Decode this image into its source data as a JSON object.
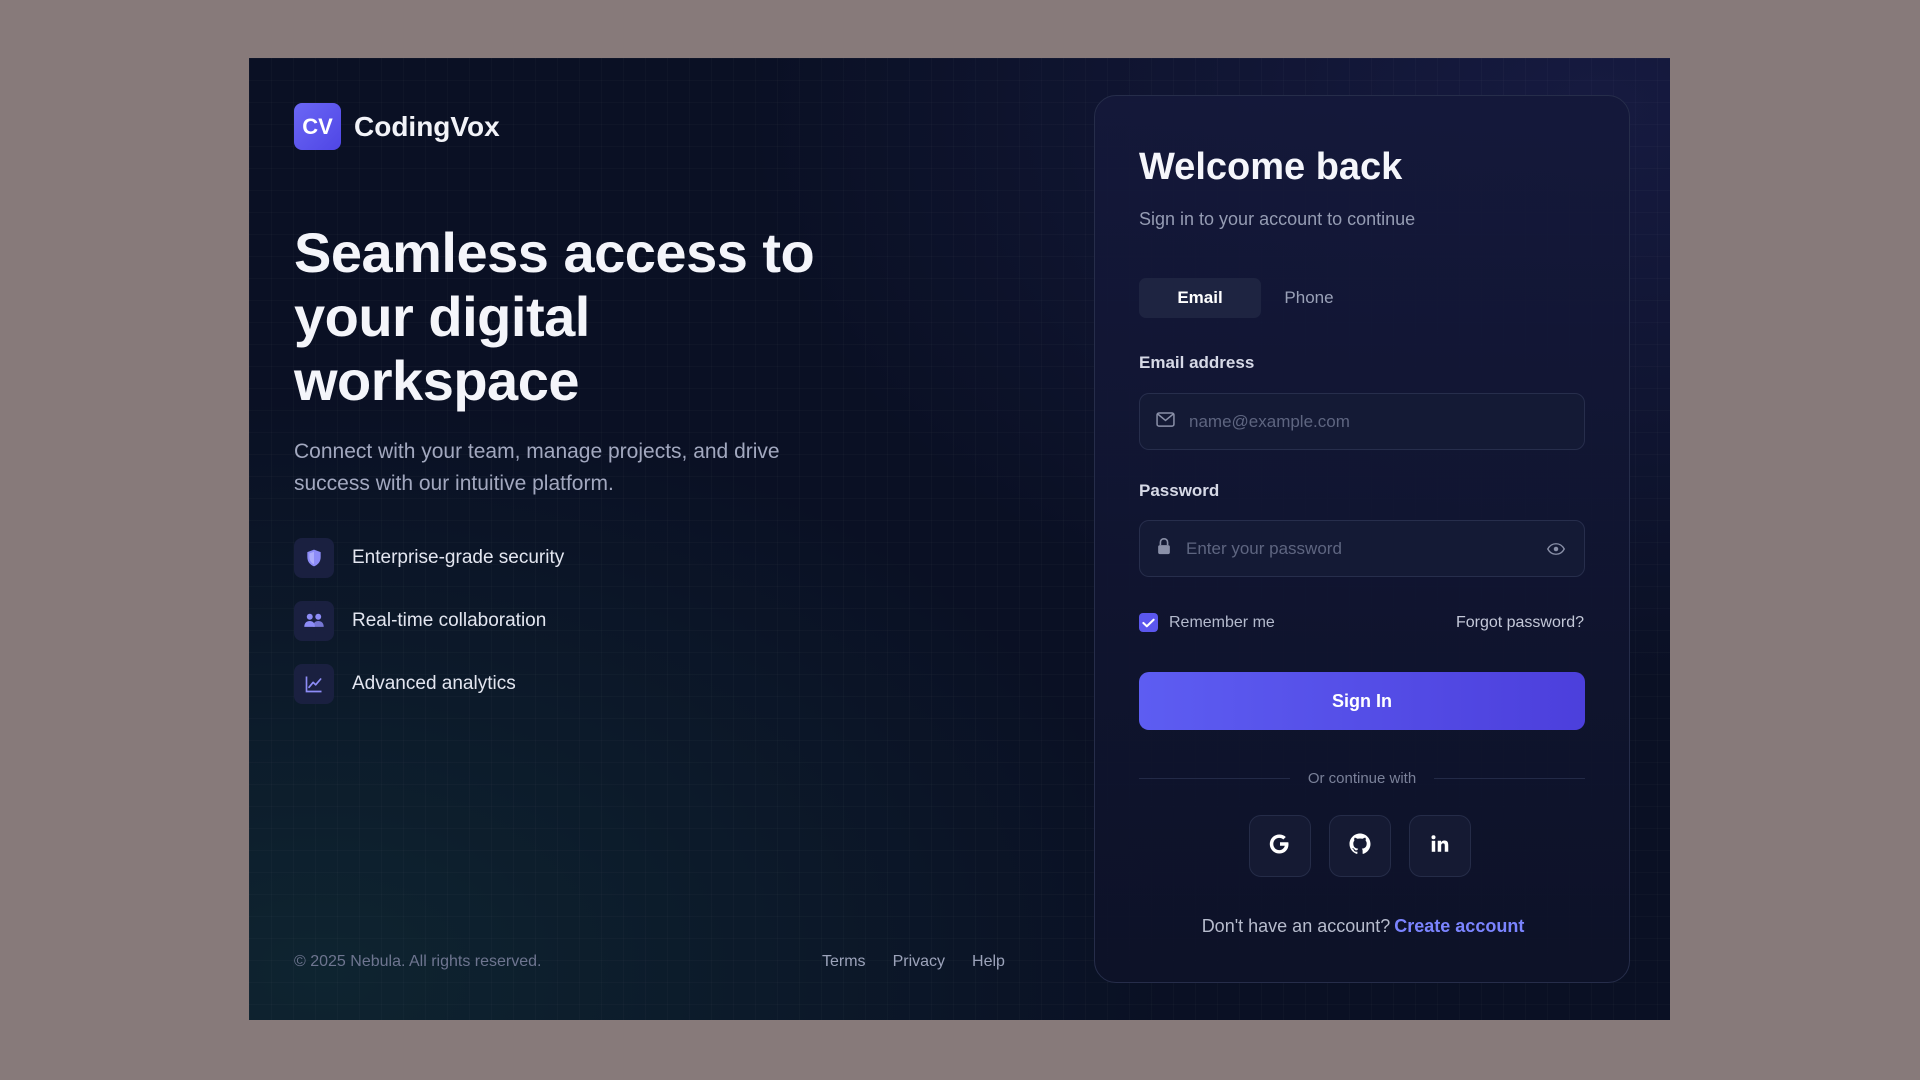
{
  "brand": {
    "logo_text": "CV",
    "name": "CodingVox"
  },
  "hero": {
    "title": "Seamless access to your digital workspace",
    "subtitle": "Connect with your team, manage projects, and drive success with our intuitive platform."
  },
  "features": [
    {
      "icon": "shield-icon",
      "label": "Enterprise-grade security"
    },
    {
      "icon": "users-icon",
      "label": "Real-time collaboration"
    },
    {
      "icon": "chart-line-icon",
      "label": "Advanced analytics"
    }
  ],
  "footer": {
    "copyright": "© 2025 Nebula. All rights reserved.",
    "links": [
      "Terms",
      "Privacy",
      "Help"
    ]
  },
  "login": {
    "title": "Welcome back",
    "subtitle": "Sign in to your account to continue",
    "tabs": [
      {
        "label": "Email",
        "active": true
      },
      {
        "label": "Phone",
        "active": false
      }
    ],
    "email": {
      "label": "Email address",
      "placeholder": "name@example.com",
      "value": ""
    },
    "password": {
      "label": "Password",
      "placeholder": "Enter your password",
      "value": ""
    },
    "remember_label": "Remember me",
    "remember_checked": true,
    "forgot_label": "Forgot password?",
    "submit_label": "Sign In",
    "divider_text": "Or continue with",
    "social": [
      "google-icon",
      "github-icon",
      "linkedin-icon"
    ],
    "signup_prompt": "Don't have an account?",
    "signup_link": "Create account"
  },
  "colors": {
    "page_background": "#877a7a",
    "panel_background": "#0a1024",
    "accent": "#5b57ee",
    "link": "#7b84ff"
  }
}
